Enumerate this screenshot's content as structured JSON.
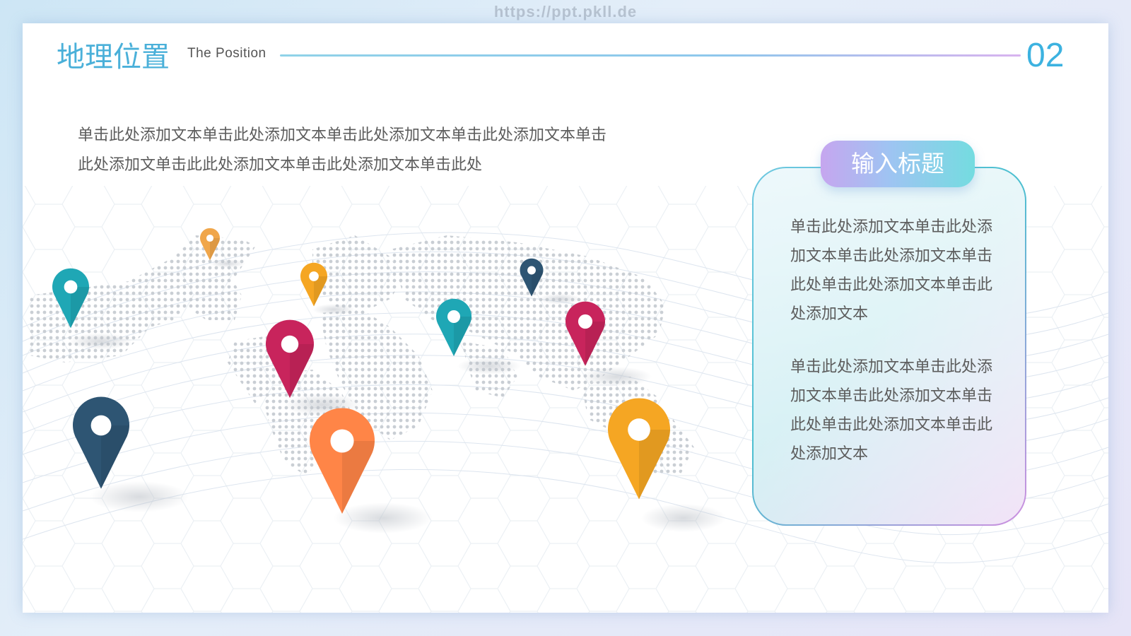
{
  "watermark": "https://ppt.pkll.de",
  "header": {
    "title_cn": "地理位置",
    "title_en": "The Position",
    "page_number": "02"
  },
  "body_text": {
    "line1": "单击此处添加文本单击此处添加文本单击此处添加文本单击此处添加文本单击",
    "line2": "此处添加文单击此此处添加文本单击此处添加文本单击此处"
  },
  "card": {
    "title": "输入标题",
    "paragraph1": [
      "单击此处添加文本单击此处添",
      "加文本单击此处添加文本单击",
      "此处单击此处添加文本单击此",
      "处添加文本"
    ],
    "paragraph2": [
      "单击此处添加文本单击此处添",
      "加文本单击此处添加文本单击",
      "此处单击此处添加文本单击此",
      "处添加文本"
    ]
  },
  "map_pins": [
    {
      "name": "teal",
      "color": "#1fa7b5"
    },
    {
      "name": "orange",
      "color": "#f0a64a"
    },
    {
      "name": "amber",
      "color": "#f5a623"
    },
    {
      "name": "navy",
      "color": "#2e5573"
    },
    {
      "name": "teal",
      "color": "#1fa7b5"
    },
    {
      "name": "crimson",
      "color": "#c8245c"
    },
    {
      "name": "crimson",
      "color": "#c8245c"
    },
    {
      "name": "navy",
      "color": "#2e5573"
    },
    {
      "name": "orange",
      "color": "#ff8547"
    },
    {
      "name": "amber",
      "color": "#f5a623"
    }
  ]
}
